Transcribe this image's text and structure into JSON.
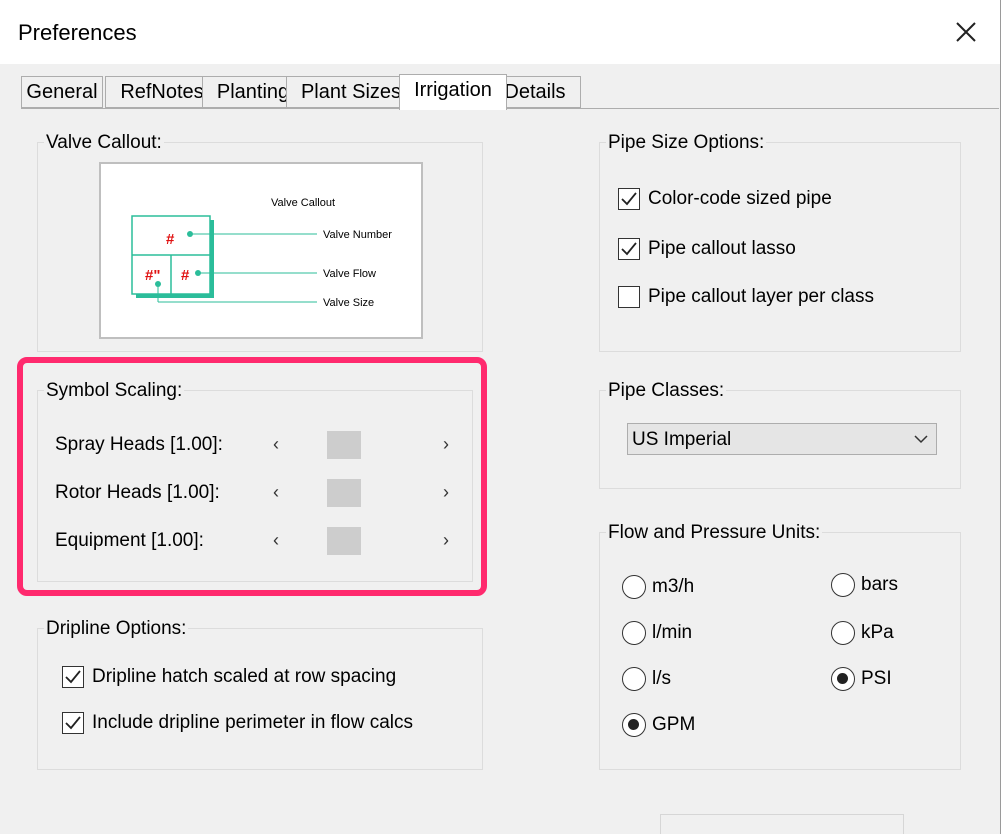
{
  "window": {
    "title": "Preferences"
  },
  "tabs": [
    {
      "label": "General"
    },
    {
      "label": "RefNotes"
    },
    {
      "label": "Planting"
    },
    {
      "label": "Plant Sizes"
    },
    {
      "label": "Irrigation",
      "active": true
    },
    {
      "label": "Details"
    }
  ],
  "valve_callout": {
    "legend": "Valve Callout:",
    "preview": {
      "title": "Valve Callout",
      "valve_number": "Valve Number",
      "valve_flow": "Valve Flow",
      "valve_size": "Valve Size",
      "hash": "#",
      "hash_size": "#\""
    }
  },
  "symbol_scaling": {
    "legend": "Symbol Scaling:",
    "rows": [
      {
        "label": "Spray Heads [1.00]:"
      },
      {
        "label": "Rotor Heads [1.00]:"
      },
      {
        "label": "Equipment [1.00]:"
      }
    ]
  },
  "dripline": {
    "legend": "Dripline Options:",
    "items": [
      {
        "label": "Dripline hatch scaled at row spacing",
        "checked": true
      },
      {
        "label": "Include dripline perimeter in flow calcs",
        "checked": true
      }
    ]
  },
  "pipe_size": {
    "legend": "Pipe Size Options:",
    "items": [
      {
        "label": "Color-code sized pipe",
        "checked": true
      },
      {
        "label": "Pipe callout lasso",
        "checked": true
      },
      {
        "label": "Pipe callout layer per class",
        "checked": false
      }
    ]
  },
  "pipe_classes": {
    "legend": "Pipe Classes:",
    "selected": "US Imperial"
  },
  "units": {
    "legend": "Flow and Pressure Units:",
    "flow": [
      {
        "label": "m3/h",
        "selected": false
      },
      {
        "label": "l/min",
        "selected": false
      },
      {
        "label": "l/s",
        "selected": false
      },
      {
        "label": "GPM",
        "selected": true
      }
    ],
    "pressure": [
      {
        "label": "bars",
        "selected": false
      },
      {
        "label": "kPa",
        "selected": false
      },
      {
        "label": "PSI",
        "selected": true
      }
    ]
  },
  "colors": {
    "highlight": "#ff2a6e",
    "callout_teal": "#2bbd9a",
    "callout_red": "#e01010"
  }
}
